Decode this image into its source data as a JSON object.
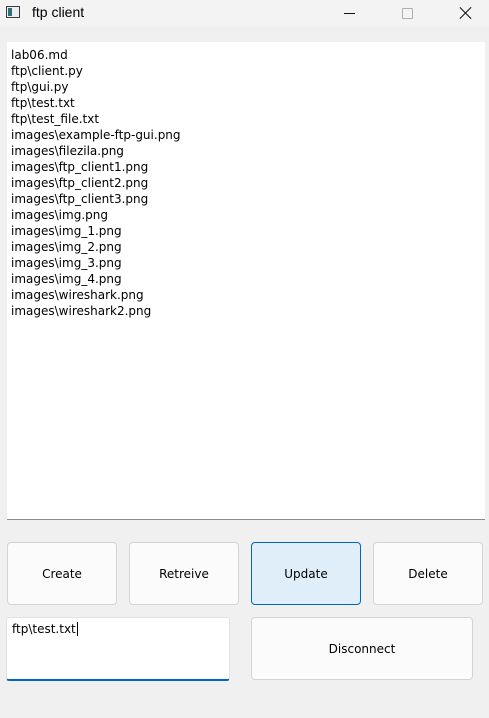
{
  "window": {
    "title": "ftp client",
    "icon": "app-window-icon"
  },
  "file_list": {
    "items": [
      "lab06.md",
      "ftp\\client.py",
      "ftp\\gui.py",
      "ftp\\test.txt",
      "ftp\\test_file.txt",
      "images\\example-ftp-gui.png",
      "images\\filezila.png",
      "images\\ftp_client1.png",
      "images\\ftp_client2.png",
      "images\\ftp_client3.png",
      "images\\img.png",
      "images\\img_1.png",
      "images\\img_2.png",
      "images\\img_3.png",
      "images\\img_4.png",
      "images\\wireshark.png",
      "images\\wireshark2.png"
    ]
  },
  "buttons": {
    "create": "Create",
    "retrieve": "Retreive",
    "update": "Update",
    "delete": "Delete",
    "disconnect": "Disconnect"
  },
  "path_input": {
    "value": "ftp\\test.txt"
  },
  "colors": {
    "accent": "#0067c0",
    "focused_button_bg": "#e0eef9"
  }
}
